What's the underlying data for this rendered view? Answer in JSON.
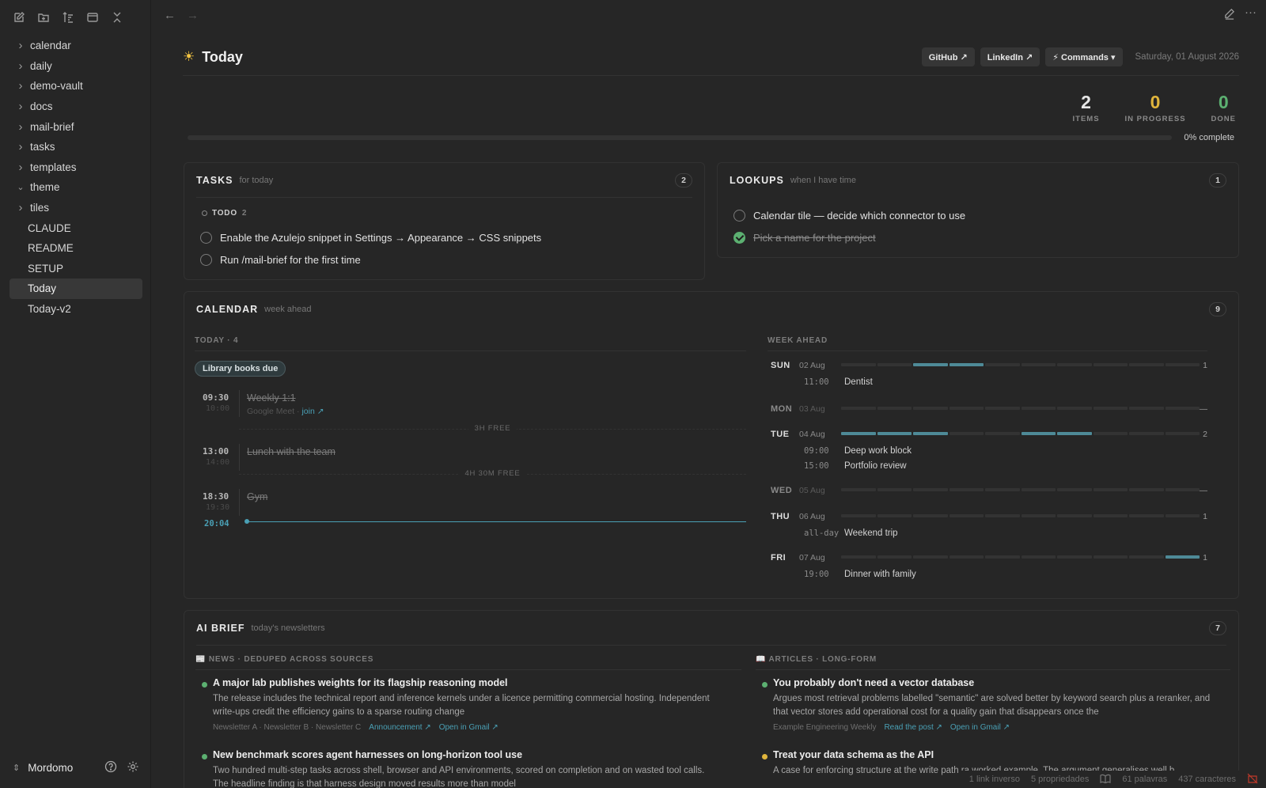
{
  "sidebar": {
    "toolbar": [
      "new-note-icon",
      "new-folder-icon",
      "sort-icon",
      "collapse-view-icon",
      "collapse-all-icon"
    ],
    "items": [
      {
        "label": "calendar",
        "type": "folder",
        "expanded": false
      },
      {
        "label": "daily",
        "type": "folder",
        "expanded": false
      },
      {
        "label": "demo-vault",
        "type": "folder",
        "expanded": false
      },
      {
        "label": "docs",
        "type": "folder",
        "expanded": false
      },
      {
        "label": "mail-brief",
        "type": "folder",
        "expanded": false
      },
      {
        "label": "tasks",
        "type": "folder",
        "expanded": false
      },
      {
        "label": "templates",
        "type": "folder",
        "expanded": false
      },
      {
        "label": "theme",
        "type": "folder",
        "expanded": true
      },
      {
        "label": "tiles",
        "type": "folder",
        "expanded": false
      },
      {
        "label": "CLAUDE",
        "type": "file"
      },
      {
        "label": "README",
        "type": "file"
      },
      {
        "label": "SETUP",
        "type": "file"
      },
      {
        "label": "Today",
        "type": "file",
        "active": true
      },
      {
        "label": "Today-v2",
        "type": "file"
      }
    ],
    "vault_name": "Mordomo"
  },
  "header": {
    "title": "Today",
    "buttons": {
      "github": "GitHub ↗",
      "linkedin": "LinkedIn ↗",
      "commands": "⚡ Commands ▾"
    },
    "date": "Saturday, 01 August 2026"
  },
  "stats": {
    "items": {
      "value": "2",
      "label": "ITEMS"
    },
    "in_progress": {
      "value": "0",
      "label": "IN PROGRESS"
    },
    "done": {
      "value": "0",
      "label": "DONE"
    },
    "progress_fraction": 0,
    "progress_label": "0% complete"
  },
  "tasks": {
    "title": "TASKS",
    "subtitle": "for today",
    "count": "2",
    "group_label": "TODO",
    "group_count": "2",
    "items": [
      "Enable the Azulejo snippet in Settings → Appearance → CSS snippets",
      "Run /mail-brief for the first time"
    ]
  },
  "lookups": {
    "title": "LOOKUPS",
    "subtitle": "when I have time",
    "count": "1",
    "items": [
      {
        "text": "Calendar tile — decide which connector to use",
        "done": false
      },
      {
        "text": "Pick a name for the project",
        "done": true
      }
    ]
  },
  "calendar": {
    "title": "CALENDAR",
    "subtitle": "week ahead",
    "count": "9",
    "today_label": "TODAY · 4",
    "allday_pill": "Library books due",
    "events": [
      {
        "start": "09:30",
        "end": "10:00",
        "name": "Weekly 1:1",
        "sub": "Google Meet · ",
        "link": "join ↗"
      },
      {
        "start": "13:00",
        "end": "14:00",
        "name": "Lunch with the team"
      },
      {
        "start": "18:30",
        "end": "19:30",
        "name": "Gym"
      }
    ],
    "gaps": [
      "3H FREE",
      "4H 30M FREE"
    ],
    "now": "20:04",
    "week_label": "WEEK AHEAD",
    "week": [
      {
        "day": "SUN",
        "date": "02 Aug",
        "count": "1",
        "blocks": [
          2,
          3
        ],
        "items": [
          {
            "time": "11:00",
            "name": "Dentist"
          }
        ]
      },
      {
        "day": "MON",
        "date": "03 Aug",
        "count": "—",
        "blocks": [],
        "items": []
      },
      {
        "day": "TUE",
        "date": "04 Aug",
        "count": "2",
        "blocks": [
          0,
          1,
          2,
          5,
          6
        ],
        "items": [
          {
            "time": "09:00",
            "name": "Deep work block"
          },
          {
            "time": "15:00",
            "name": "Portfolio review"
          }
        ]
      },
      {
        "day": "WED",
        "date": "05 Aug",
        "count": "—",
        "blocks": [],
        "items": []
      },
      {
        "day": "THU",
        "date": "06 Aug",
        "count": "1",
        "blocks": [],
        "items": [
          {
            "time": "all-day",
            "name": "Weekend trip"
          }
        ]
      },
      {
        "day": "FRI",
        "date": "07 Aug",
        "count": "1",
        "blocks": [
          9
        ],
        "items": [
          {
            "time": "19:00",
            "name": "Dinner with family"
          }
        ]
      }
    ]
  },
  "brief": {
    "title": "AI BRIEF",
    "subtitle": "today's newsletters",
    "count": "7",
    "news_label": "📰 NEWS · DEDUPED ACROSS SOURCES",
    "articles_label": "📖 ARTICLES · LONG-FORM",
    "news": [
      {
        "title": "A major lab publishes weights for its flagship reasoning model",
        "body": "The release includes the technical report and inference kernels under a licence permitting commercial hosting. Independent write-ups credit the efficiency gains to a sparse routing change",
        "meta": "Newsletter A · Newsletter B · Newsletter C",
        "link1": "Announcement ↗",
        "link2": "Open in Gmail ↗",
        "color": "#5cb071"
      },
      {
        "title": "New benchmark scores agent harnesses on long-horizon tool use",
        "body": "Two hundred multi-step tasks across shell, browser and API environments, scored on completion and on wasted tool calls. The headline finding is that harness design moved results more than model",
        "color": "#5cb071"
      }
    ],
    "articles": [
      {
        "title": "You probably don't need a vector database",
        "body": "Argues most retrieval problems labelled \"semantic\" are solved better by keyword search plus a reranker, and that vector stores add operational cost for a quality gain that disappears once the",
        "meta": "Example Engineering Weekly",
        "link1": "Read the post ↗",
        "link2": "Open in Gmail ↗",
        "color": "#5cb071"
      },
      {
        "title": "Treat your data schema as the API",
        "body": "A case for enforcing structure at the write path ra worked example. The argument generalises well b",
        "color": "#e0b53c"
      }
    ]
  },
  "statusbar": {
    "backlinks": "1 link inverso",
    "properties": "5 propriedades",
    "words": "61 palavras",
    "chars": "437 caracteres"
  },
  "colors": {
    "accent": "#4aa0b5",
    "in_progress": "#e0b53c",
    "done": "#5cb071"
  }
}
